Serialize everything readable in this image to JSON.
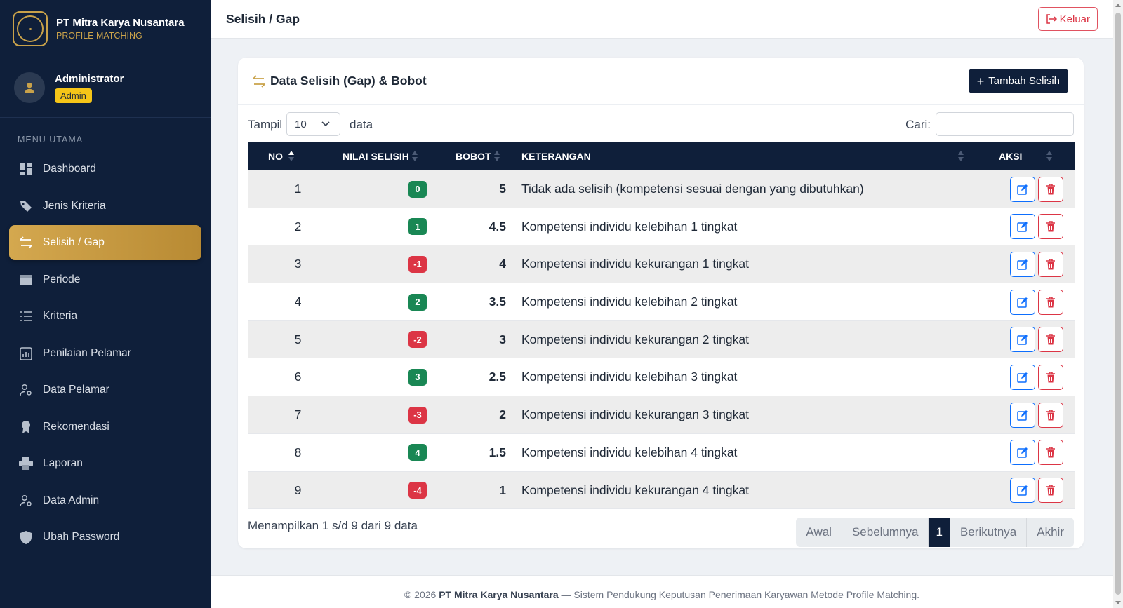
{
  "brand": {
    "name": "PT Mitra Karya Nusantara",
    "subtitle": "PROFILE MATCHING"
  },
  "user": {
    "name": "Administrator",
    "role": "Admin"
  },
  "menu": {
    "section_label": "MENU UTAMA",
    "items": [
      {
        "label": "Dashboard",
        "icon": "dashboard-icon"
      },
      {
        "label": "Jenis Kriteria",
        "icon": "tag-icon"
      },
      {
        "label": "Selisih / Gap",
        "icon": "arrows-exchange-icon",
        "active": true
      },
      {
        "label": "Periode",
        "icon": "calendar-icon"
      },
      {
        "label": "Kriteria",
        "icon": "list-icon"
      },
      {
        "label": "Penilaian Pelamar",
        "icon": "clipboard-chart-icon"
      },
      {
        "label": "Data Pelamar",
        "icon": "user-gear-icon"
      },
      {
        "label": "Rekomendasi",
        "icon": "award-icon"
      },
      {
        "label": "Laporan",
        "icon": "printer-icon"
      },
      {
        "label": "Data Admin",
        "icon": "user-gear-icon"
      },
      {
        "label": "Ubah Password",
        "icon": "shield-icon"
      }
    ]
  },
  "topbar": {
    "title": "Selisih / Gap",
    "logout_label": "Keluar"
  },
  "card": {
    "title": "Data Selisih (Gap) & Bobot",
    "add_label": "Tambah Selisih"
  },
  "controls": {
    "show_label": "Tampil",
    "page_length": "10",
    "data_label": "data",
    "search_label": "Cari:",
    "search_value": ""
  },
  "table": {
    "headers": {
      "no": "NO",
      "nilai": "NILAI SELISIH",
      "bobot": "BOBOT",
      "keterangan": "KETERANGAN",
      "aksi": "AKSI"
    },
    "rows": [
      {
        "no": "1",
        "nilai": "0",
        "sign": "pos",
        "bobot": "5",
        "keterangan": "Tidak ada selisih (kompetensi sesuai dengan yang dibutuhkan)"
      },
      {
        "no": "2",
        "nilai": "1",
        "sign": "pos",
        "bobot": "4.5",
        "keterangan": "Kompetensi individu kelebihan 1 tingkat"
      },
      {
        "no": "3",
        "nilai": "-1",
        "sign": "neg",
        "bobot": "4",
        "keterangan": "Kompetensi individu kekurangan 1 tingkat"
      },
      {
        "no": "4",
        "nilai": "2",
        "sign": "pos",
        "bobot": "3.5",
        "keterangan": "Kompetensi individu kelebihan 2 tingkat"
      },
      {
        "no": "5",
        "nilai": "-2",
        "sign": "neg",
        "bobot": "3",
        "keterangan": "Kompetensi individu kekurangan 2 tingkat"
      },
      {
        "no": "6",
        "nilai": "3",
        "sign": "pos",
        "bobot": "2.5",
        "keterangan": "Kompetensi individu kelebihan 3 tingkat"
      },
      {
        "no": "7",
        "nilai": "-3",
        "sign": "neg",
        "bobot": "2",
        "keterangan": "Kompetensi individu kekurangan 3 tingkat"
      },
      {
        "no": "8",
        "nilai": "4",
        "sign": "pos",
        "bobot": "1.5",
        "keterangan": "Kompetensi individu kelebihan 4 tingkat"
      },
      {
        "no": "9",
        "nilai": "-4",
        "sign": "neg",
        "bobot": "1",
        "keterangan": "Kompetensi individu kekurangan 4 tingkat"
      }
    ]
  },
  "info": "Menampilkan 1 s/d 9 dari 9 data",
  "pagination": {
    "first": "Awal",
    "prev": "Sebelumnya",
    "current": "1",
    "next": "Berikutnya",
    "last": "Akhir"
  },
  "footer": {
    "prefix": "© 2026",
    "company": "PT Mitra Karya Nusantara",
    "suffix": "— Sistem Pendukung Keputusan Penerimaan Karyawan Metode Profile Matching."
  },
  "colors": {
    "sidebar": "#0f1f3a",
    "accent_gold": "#c9a24a",
    "positive": "#198754",
    "negative": "#dc3545"
  }
}
